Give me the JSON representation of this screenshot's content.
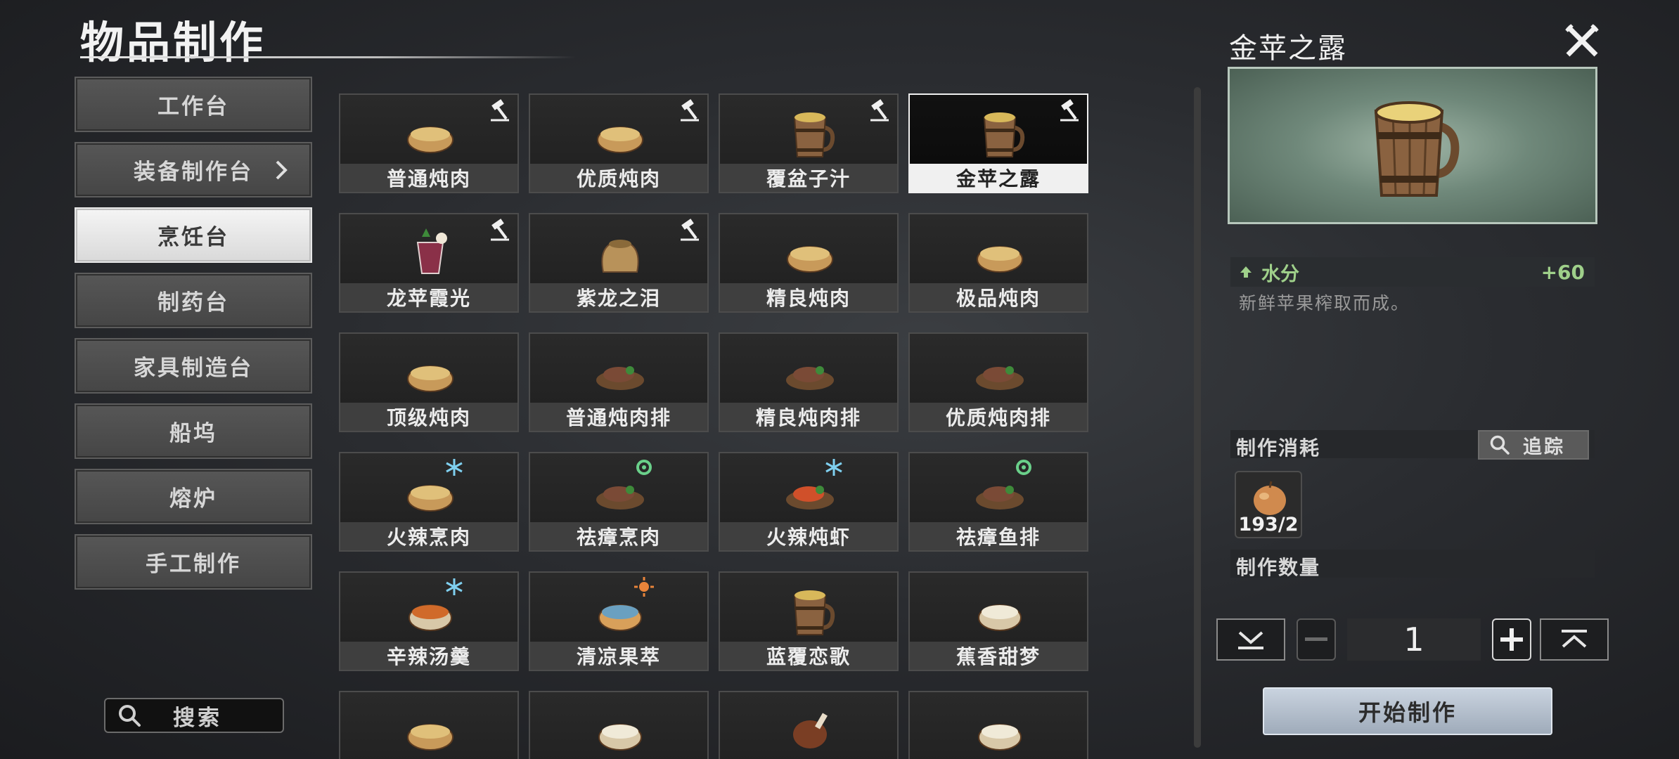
{
  "header": {
    "title": "物品制作"
  },
  "sidebar": {
    "items": [
      {
        "label": "工作台"
      },
      {
        "label": "装备制作台"
      },
      {
        "label": "烹饪台"
      },
      {
        "label": "制药台"
      },
      {
        "label": "家具制造台"
      },
      {
        "label": "船坞"
      },
      {
        "label": "熔炉"
      },
      {
        "label": "手工制作"
      }
    ],
    "active_index": 2,
    "search_label": "搜索"
  },
  "recipes": [
    {
      "name": "普通炖肉",
      "food": "stew-bowl-icon",
      "craftable": true
    },
    {
      "name": "优质炖肉",
      "food": "stew-bowl-icon",
      "craftable": true
    },
    {
      "name": "覆盆子汁",
      "food": "wooden-mug-icon",
      "craftable": true
    },
    {
      "name": "金苹之露",
      "food": "wooden-mug-icon",
      "craftable": true,
      "selected": true
    },
    {
      "name": "龙苹霞光",
      "food": "cocktail-glass-icon",
      "craftable": true
    },
    {
      "name": "紫龙之泪",
      "food": "sack-icon",
      "craftable": true
    },
    {
      "name": "精良炖肉",
      "food": "stew-bowl-icon",
      "craftable": false
    },
    {
      "name": "极品炖肉",
      "food": "stew-bowl-icon",
      "craftable": false
    },
    {
      "name": "顶级炖肉",
      "food": "stew-bowl-icon",
      "craftable": false
    },
    {
      "name": "普通炖肉排",
      "food": "meat-plate-icon",
      "craftable": false
    },
    {
      "name": "精良炖肉排",
      "food": "meat-plate-icon",
      "craftable": false
    },
    {
      "name": "优质炖肉排",
      "food": "meat-plate-icon",
      "craftable": false
    },
    {
      "name": "火辣烹肉",
      "food": "stew-bowl-icon",
      "badge": "snowflake-icon"
    },
    {
      "name": "祛瘴烹肉",
      "food": "meat-plate-icon",
      "badge": "gear-badge-icon"
    },
    {
      "name": "火辣炖虾",
      "food": "shrimp-plate-icon",
      "badge": "snowflake-icon"
    },
    {
      "name": "祛瘴鱼排",
      "food": "fish-plate-icon",
      "badge": "gear-badge-icon"
    },
    {
      "name": "辛辣汤羹",
      "food": "soup-bowl-icon",
      "badge": "snowflake-icon"
    },
    {
      "name": "清凉果萃",
      "food": "fruit-bowl-icon",
      "badge": "sun-icon"
    },
    {
      "name": "蓝覆恋歌",
      "food": "wooden-mug-icon"
    },
    {
      "name": "蕉香甜梦",
      "food": "dessert-bowl-icon"
    },
    {
      "name": "",
      "food": "stew-bowl-icon"
    },
    {
      "name": "",
      "food": "dessert-bowl-icon"
    },
    {
      "name": "",
      "food": "roast-leg-icon"
    },
    {
      "name": "",
      "food": "rice-plate-icon"
    }
  ],
  "detail": {
    "title": "金苹之露",
    "stat": {
      "name": "水分",
      "value": "+60"
    },
    "description": "新鲜苹果榨取而成。",
    "consume_label": "制作消耗",
    "track_label": "追踪",
    "material": {
      "icon": "apple-icon",
      "count": "193/2"
    },
    "quantity_label": "制作数量",
    "quantity": "1",
    "start_label": "开始制作"
  },
  "colors": {
    "accent_green": "#9fd08a",
    "selected_bg": "#f0f0f0",
    "button_blue": "#b7c3d0"
  }
}
